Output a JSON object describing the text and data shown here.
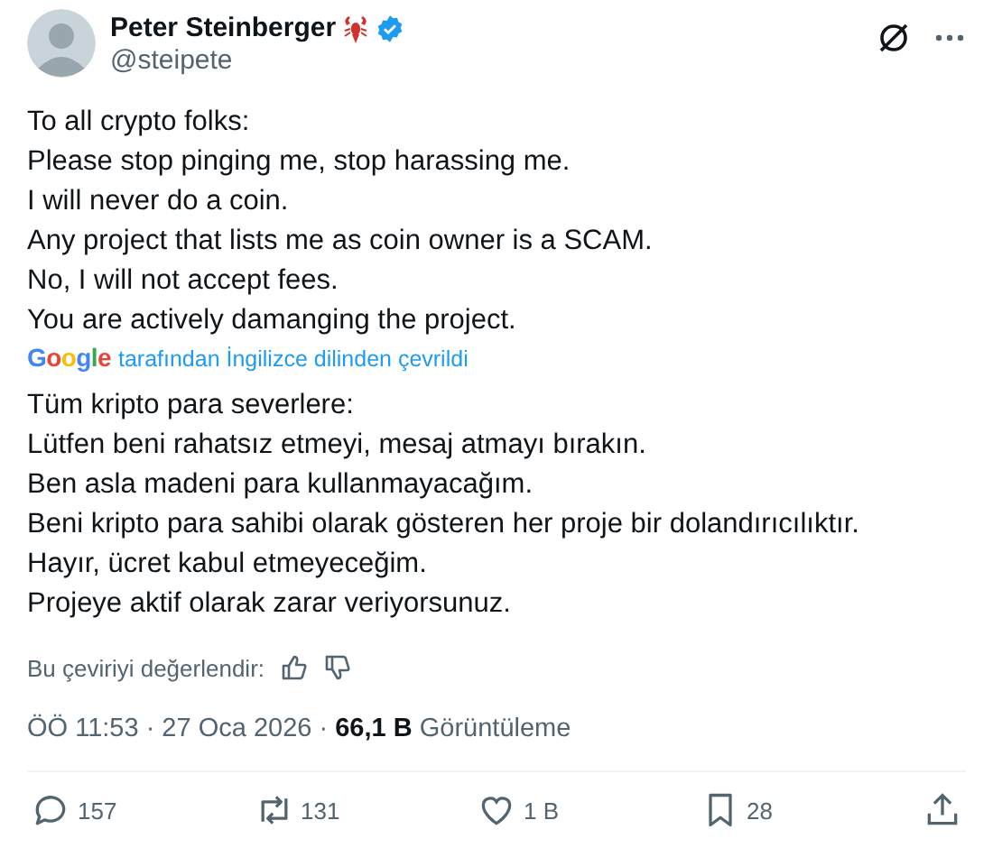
{
  "author": {
    "name": "Peter Steinberger",
    "verified": true,
    "handle": "@steipete"
  },
  "original_lines": [
    "To all crypto folks:",
    "Please stop pinging me, stop harassing me.",
    "I will never do a coin.",
    "Any project that lists me as coin owner is a SCAM.",
    "No, I will not accept fees.",
    "You are actively damanging the project."
  ],
  "translation_note": {
    "brand": "Google",
    "text": "tarafından İngilizce dilinden çevrildi"
  },
  "translated_lines": [
    "Tüm kripto para severlere:",
    "Lütfen beni rahatsız etmeyi, mesaj atmayı bırakın.",
    "Ben asla madeni para kullanmayacağım.",
    "Beni kripto para sahibi olarak gösteren her proje bir dolandırıcılıktır.",
    "Hayır, ücret kabul etmeyeceğim.",
    "Projeye aktif olarak zarar veriyorsunuz."
  ],
  "rate_translation": "Bu çeviriyi değerlendir:",
  "meta": "ÖÖ 11:53 · 27 Oca 2026 · **66,1 B** Görüntüleme",
  "actions": [
    {
      "kind": "reply",
      "count": "157"
    },
    {
      "kind": "repost",
      "count": "131"
    },
    {
      "kind": "like",
      "count": "1 B"
    },
    {
      "kind": "bookmark",
      "count": "28"
    },
    {
      "kind": "share"
    }
  ]
}
